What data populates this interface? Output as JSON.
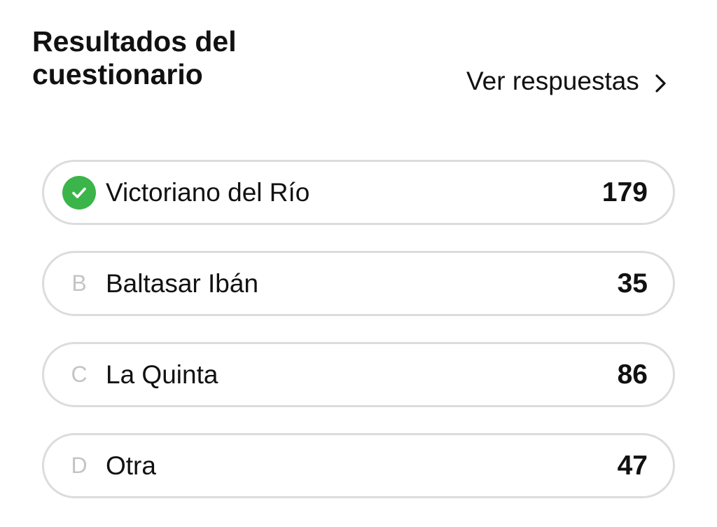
{
  "header": {
    "title": "Resultados del cuestionario",
    "view_answers": "Ver respuestas",
    "view_answers_icon": "chevron-right-icon"
  },
  "options": [
    {
      "marker": "",
      "marker_icon": "check-circle-icon",
      "correct": true,
      "label": "Victoriano del Río",
      "count": "179"
    },
    {
      "marker": "B",
      "label": "Baltasar Ibán",
      "count": "35"
    },
    {
      "marker": "C",
      "label": "La Quinta",
      "count": "86"
    },
    {
      "marker": "D",
      "label": "Otra",
      "count": "47"
    }
  ],
  "colors": {
    "correct": "#3bb54a",
    "border": "#dcdcdc",
    "marker_letter": "#c4c4c4"
  }
}
